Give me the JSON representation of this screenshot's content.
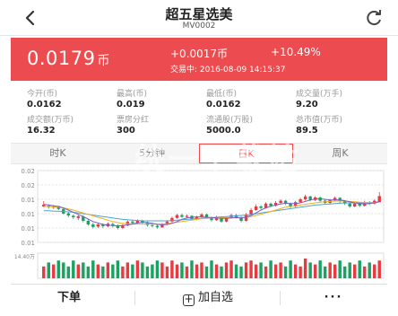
{
  "header": {
    "title": "超五星选美",
    "code": "MV0002"
  },
  "icons": {
    "back": "chevron-left-icon",
    "refresh": "refresh-icon",
    "add": "plus-square-icon"
  },
  "colors": {
    "accent": "#ec4b4f",
    "up": "#e83b3f",
    "down": "#1aa260",
    "ma5": "#7a5cc7",
    "ma10": "#f0b020",
    "ma20": "#4aa3d8"
  },
  "banner": {
    "price": "0.0179",
    "price_unit": "币",
    "change": "+0.0017币",
    "percent": "+10.49%",
    "status": "交易中: 2016-08-09 14:15:37"
  },
  "stats": [
    {
      "label": "今开(币)",
      "value": "0.0162"
    },
    {
      "label": "最高(币)",
      "value": "0.019"
    },
    {
      "label": "最低(币)",
      "value": "0.0162"
    },
    {
      "label": "成交量(万手)",
      "value": "9.20"
    },
    {
      "label": "成交额(万币)",
      "value": "16.32"
    },
    {
      "label": "票房分红",
      "value": "300"
    },
    {
      "label": "流通股(万股)",
      "value": "5000.0"
    },
    {
      "label": "总市值(万币)",
      "value": "89.5"
    }
  ],
  "tabs": [
    {
      "label": "时K"
    },
    {
      "label": "5分钟"
    },
    {
      "label": "日K"
    },
    {
      "label": "周K"
    }
  ],
  "chart_data": {
    "type": "candlestick",
    "y_ticks": [
      "0.02",
      "0.02",
      "0.01",
      "0.01",
      "0.01",
      "0.01"
    ],
    "volume_label": "14.40万",
    "ylim": [
      0.005,
      0.025
    ],
    "candles": [
      [
        0.015,
        0.0155,
        0.0165,
        0.0148
      ],
      [
        0.0152,
        0.0148,
        0.0156,
        0.0144
      ],
      [
        0.0147,
        0.015,
        0.0154,
        0.0143
      ],
      [
        0.0151,
        0.0143,
        0.0152,
        0.014
      ],
      [
        0.0143,
        0.013,
        0.0146,
        0.0128
      ],
      [
        0.0131,
        0.0125,
        0.0135,
        0.012
      ],
      [
        0.0124,
        0.012,
        0.0128,
        0.0115
      ],
      [
        0.0118,
        0.0123,
        0.0126,
        0.0112
      ],
      [
        0.0122,
        0.011,
        0.0125,
        0.0106
      ],
      [
        0.011,
        0.01,
        0.0114,
        0.0096
      ],
      [
        0.01,
        0.0093,
        0.0105,
        0.0089
      ],
      [
        0.0094,
        0.01,
        0.0104,
        0.009
      ],
      [
        0.0099,
        0.0095,
        0.0103,
        0.009
      ],
      [
        0.0095,
        0.0102,
        0.0106,
        0.0092
      ],
      [
        0.0101,
        0.0096,
        0.0105,
        0.0091
      ],
      [
        0.0096,
        0.009,
        0.01,
        0.0086
      ],
      [
        0.009,
        0.0098,
        0.0101,
        0.0087
      ],
      [
        0.0097,
        0.0108,
        0.0111,
        0.0095
      ],
      [
        0.0108,
        0.0104,
        0.0113,
        0.01
      ],
      [
        0.0104,
        0.011,
        0.0114,
        0.0101
      ],
      [
        0.011,
        0.0106,
        0.0113,
        0.0102
      ],
      [
        0.0106,
        0.0098,
        0.0108,
        0.0094
      ],
      [
        0.0098,
        0.0096,
        0.0102,
        0.0092
      ],
      [
        0.0096,
        0.0092,
        0.0099,
        0.0088
      ],
      [
        0.0092,
        0.01,
        0.0104,
        0.009
      ],
      [
        0.01,
        0.0108,
        0.0112,
        0.0098
      ],
      [
        0.0108,
        0.0118,
        0.0122,
        0.0106
      ],
      [
        0.0118,
        0.0126,
        0.013,
        0.0116
      ],
      [
        0.0126,
        0.0121,
        0.013,
        0.0118
      ],
      [
        0.0121,
        0.0124,
        0.0128,
        0.0118
      ],
      [
        0.0124,
        0.0115,
        0.0126,
        0.0112
      ],
      [
        0.0115,
        0.012,
        0.0124,
        0.0112
      ],
      [
        0.012,
        0.0128,
        0.0132,
        0.0118
      ],
      [
        0.0128,
        0.0119,
        0.013,
        0.0116
      ],
      [
        0.0119,
        0.0112,
        0.0122,
        0.0108
      ],
      [
        0.0112,
        0.0121,
        0.0124,
        0.011
      ],
      [
        0.0121,
        0.0108,
        0.0123,
        0.0105
      ],
      [
        0.0108,
        0.0118,
        0.0121,
        0.0106
      ],
      [
        0.0118,
        0.0126,
        0.013,
        0.0116
      ],
      [
        0.0126,
        0.012,
        0.0129,
        0.0117
      ],
      [
        0.012,
        0.011,
        0.0123,
        0.0106
      ],
      [
        0.011,
        0.0128,
        0.0132,
        0.0108
      ],
      [
        0.0128,
        0.014,
        0.0146,
        0.0126
      ],
      [
        0.014,
        0.015,
        0.0156,
        0.0138
      ],
      [
        0.015,
        0.0146,
        0.0154,
        0.0142
      ],
      [
        0.0146,
        0.0158,
        0.0162,
        0.0144
      ],
      [
        0.0158,
        0.0152,
        0.0161,
        0.0148
      ],
      [
        0.0152,
        0.016,
        0.0165,
        0.015
      ],
      [
        0.016,
        0.0166,
        0.017,
        0.0156
      ],
      [
        0.0166,
        0.0158,
        0.0168,
        0.0154
      ],
      [
        0.0158,
        0.015,
        0.0161,
        0.0146
      ],
      [
        0.015,
        0.0162,
        0.0166,
        0.0148
      ],
      [
        0.0162,
        0.017,
        0.0174,
        0.016
      ],
      [
        0.017,
        0.0178,
        0.0183,
        0.0166
      ],
      [
        0.0178,
        0.0168,
        0.018,
        0.0164
      ],
      [
        0.0168,
        0.0175,
        0.0179,
        0.0165
      ],
      [
        0.0175,
        0.0166,
        0.0178,
        0.0162
      ],
      [
        0.0166,
        0.016,
        0.0169,
        0.0156
      ],
      [
        0.016,
        0.0168,
        0.0171,
        0.0157
      ],
      [
        0.0168,
        0.0174,
        0.0178,
        0.0165
      ],
      [
        0.0174,
        0.0165,
        0.0176,
        0.016
      ],
      [
        0.0165,
        0.0158,
        0.0168,
        0.0154
      ],
      [
        0.0158,
        0.015,
        0.0161,
        0.0146
      ],
      [
        0.015,
        0.0158,
        0.0162,
        0.0148
      ],
      [
        0.0158,
        0.0152,
        0.016,
        0.0148
      ],
      [
        0.0152,
        0.0162,
        0.0166,
        0.015
      ],
      [
        0.0162,
        0.0158,
        0.0165,
        0.0154
      ],
      [
        0.0158,
        0.0166,
        0.017,
        0.0156
      ],
      [
        0.0162,
        0.0179,
        0.019,
        0.0162
      ]
    ],
    "ma5": [
      0.0156,
      0.0154,
      0.0152,
      0.015,
      0.0146,
      0.014,
      0.0134,
      0.0128,
      0.0122,
      0.0115,
      0.0108,
      0.0104,
      0.01,
      0.0098,
      0.0097,
      0.0096,
      0.0097,
      0.0099,
      0.0101,
      0.0104,
      0.0106,
      0.0105,
      0.0103,
      0.01,
      0.0099,
      0.01,
      0.0103,
      0.0108,
      0.0114,
      0.0118,
      0.012,
      0.0121,
      0.0121,
      0.012,
      0.0119,
      0.0118,
      0.0117,
      0.0117,
      0.0118,
      0.0119,
      0.0118,
      0.012,
      0.0125,
      0.0132,
      0.014,
      0.0146,
      0.0151,
      0.0154,
      0.0157,
      0.0159,
      0.0158,
      0.0158,
      0.016,
      0.0164,
      0.0168,
      0.0171,
      0.0171,
      0.017,
      0.0168,
      0.0168,
      0.0168,
      0.0166,
      0.0163,
      0.016,
      0.0158,
      0.0157,
      0.0158,
      0.016,
      0.0164
    ],
    "ma10": [
      0.015,
      0.015,
      0.0149,
      0.0148,
      0.0146,
      0.0143,
      0.014,
      0.0136,
      0.0132,
      0.0128,
      0.0124,
      0.012,
      0.0116,
      0.0112,
      0.0108,
      0.0105,
      0.0103,
      0.0102,
      0.0101,
      0.0101,
      0.0101,
      0.0101,
      0.0101,
      0.0101,
      0.0101,
      0.0102,
      0.0104,
      0.0106,
      0.0108,
      0.011,
      0.0112,
      0.0114,
      0.0116,
      0.0117,
      0.0118,
      0.0118,
      0.0119,
      0.0119,
      0.0119,
      0.0119,
      0.0119,
      0.012,
      0.0122,
      0.0125,
      0.0128,
      0.0132,
      0.0136,
      0.014,
      0.0144,
      0.0148,
      0.015,
      0.0152,
      0.0154,
      0.0156,
      0.0158,
      0.016,
      0.0162,
      0.0163,
      0.0164,
      0.0165,
      0.0165,
      0.0165,
      0.0164,
      0.0163,
      0.0162,
      0.0161,
      0.0161,
      0.0161,
      0.0162
    ],
    "ma20": [
      0.0138,
      0.0138,
      0.0137,
      0.0137,
      0.0136,
      0.0135,
      0.0134,
      0.0132,
      0.013,
      0.0128,
      0.0126,
      0.0124,
      0.0122,
      0.012,
      0.0118,
      0.0116,
      0.0114,
      0.0113,
      0.0112,
      0.0111,
      0.011,
      0.011,
      0.011,
      0.011,
      0.011,
      0.011,
      0.0111,
      0.0112,
      0.0113,
      0.0114,
      0.0115,
      0.0116,
      0.0117,
      0.0118,
      0.0119,
      0.012,
      0.0121,
      0.0122,
      0.0123,
      0.0124,
      0.0125,
      0.0126,
      0.0128,
      0.013,
      0.0132,
      0.0134,
      0.0136,
      0.0138,
      0.014,
      0.0142,
      0.0144,
      0.0146,
      0.0148,
      0.015,
      0.0152,
      0.0154,
      0.0155,
      0.0156,
      0.0157,
      0.0158,
      0.0159,
      0.016,
      0.016,
      0.016,
      0.016,
      0.016,
      0.0161,
      0.0161,
      0.0162
    ],
    "volumes": [
      0.6,
      0.8,
      0.7,
      0.9,
      0.8,
      0.6,
      0.9,
      0.7,
      0.8,
      0.6,
      0.9,
      0.7,
      0.6,
      0.8,
      0.7,
      0.9,
      0.6,
      0.8,
      0.7,
      0.9,
      0.8,
      0.6,
      0.7,
      0.9,
      0.8,
      0.6,
      0.9,
      0.7,
      0.8,
      0.6,
      0.9,
      0.7,
      0.8,
      0.6,
      0.9,
      0.7,
      0.6,
      0.8,
      0.9,
      0.7,
      0.6,
      0.8,
      0.9,
      0.7,
      0.8,
      0.6,
      0.9,
      0.7,
      0.8,
      0.6,
      0.9,
      0.7,
      0.6,
      1.0,
      0.8,
      0.7,
      0.9,
      0.6,
      0.8,
      0.7,
      0.9,
      0.6,
      0.8,
      0.7,
      0.9,
      0.6,
      0.8,
      0.7,
      0.9
    ]
  },
  "bottom": {
    "buy": "下单",
    "add": "加自选",
    "more": "···"
  },
  "watermark": "统一下载站"
}
